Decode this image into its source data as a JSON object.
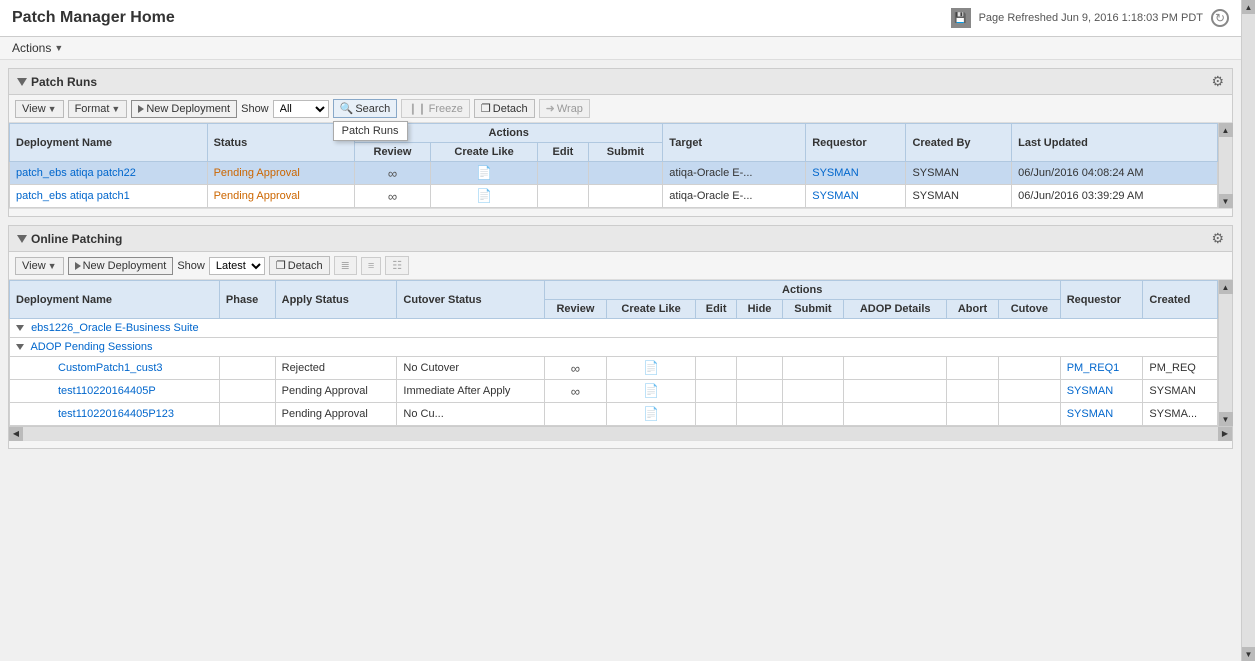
{
  "page": {
    "title": "Patch Manager Home",
    "refreshText": "Page Refreshed Jun 9, 2016 1:18:03 PM PDT",
    "actionsLabel": "Actions"
  },
  "patchRuns": {
    "title": "Patch Runs",
    "toolbar": {
      "view": "View",
      "format": "Format",
      "newDeployment": "New Deployment",
      "showLabel": "Show",
      "showValue": "All",
      "search": "Search",
      "freeze": "Freeze",
      "detach": "Detach",
      "wrap": "Wrap",
      "searchTooltip": "Patch Runs"
    },
    "columns": {
      "deploymentName": "Deployment Name",
      "status": "Status",
      "actionsHeader": "Actions",
      "review": "Review",
      "createLike": "Create Like",
      "edit": "Edit",
      "submit": "Submit",
      "target": "Target",
      "requestor": "Requestor",
      "createdBy": "Created By",
      "lastUpdated": "Last Updated"
    },
    "rows": [
      {
        "name": "patch_ebs atiqa patch22",
        "status": "Pending Approval",
        "hasLink": true,
        "hasDoc": true,
        "target": "atiqa-Oracle E-...",
        "requestor": "SYSMAN",
        "createdBy": "SYSMAN",
        "lastUpdated": "06/Jun/2016 04:08:24 AM",
        "selected": true
      },
      {
        "name": "patch_ebs atiqa patch1",
        "status": "Pending Approval",
        "hasLink": true,
        "hasDoc": true,
        "target": "atiqa-Oracle E-...",
        "requestor": "SYSMAN",
        "createdBy": "SYSMAN",
        "lastUpdated": "06/Jun/2016 03:39:29 AM",
        "selected": false
      }
    ]
  },
  "onlinePatching": {
    "title": "Online Patching",
    "toolbar": {
      "view": "View",
      "newDeployment": "New Deployment",
      "showLabel": "Show",
      "showValue": "Latest",
      "detach": "Detach"
    },
    "columns": {
      "deploymentName": "Deployment Name",
      "phase": "Phase",
      "applyStatus": "Apply Status",
      "cutoverStatus": "Cutover Status",
      "actionsHeader": "Actions",
      "review": "Review",
      "createLike": "Create Like",
      "edit": "Edit",
      "hide": "Hide",
      "submit": "Submit",
      "adopDetails": "ADOP Details",
      "abort": "Abort",
      "cutove": "Cutove",
      "requestor": "Requestor",
      "created": "Created"
    },
    "tree": {
      "group": "ebs1226_Oracle E-Business Suite",
      "subgroup": "ADOP Pending Sessions",
      "rows": [
        {
          "name": "CustomPatch1_cust3",
          "applyStatus": "Rejected",
          "cutoverStatus": "No Cutover",
          "hasLink": true,
          "hasDoc": true,
          "requestor": "PM_REQ1",
          "created": "PM_REQ"
        },
        {
          "name": "test110220164405P",
          "applyStatus": "Pending Approval",
          "cutoverStatus": "Immediate After Apply",
          "hasLink": true,
          "hasDoc": true,
          "requestor": "SYSMAN",
          "created": "SYSMAN"
        },
        {
          "name": "test110220164405P123",
          "applyStatus": "Pending Approval",
          "cutoverStatus": "No Cu...",
          "hasLink": false,
          "hasDoc": true,
          "requestor": "SYSMAN",
          "created": "SYSMA..."
        }
      ]
    }
  }
}
